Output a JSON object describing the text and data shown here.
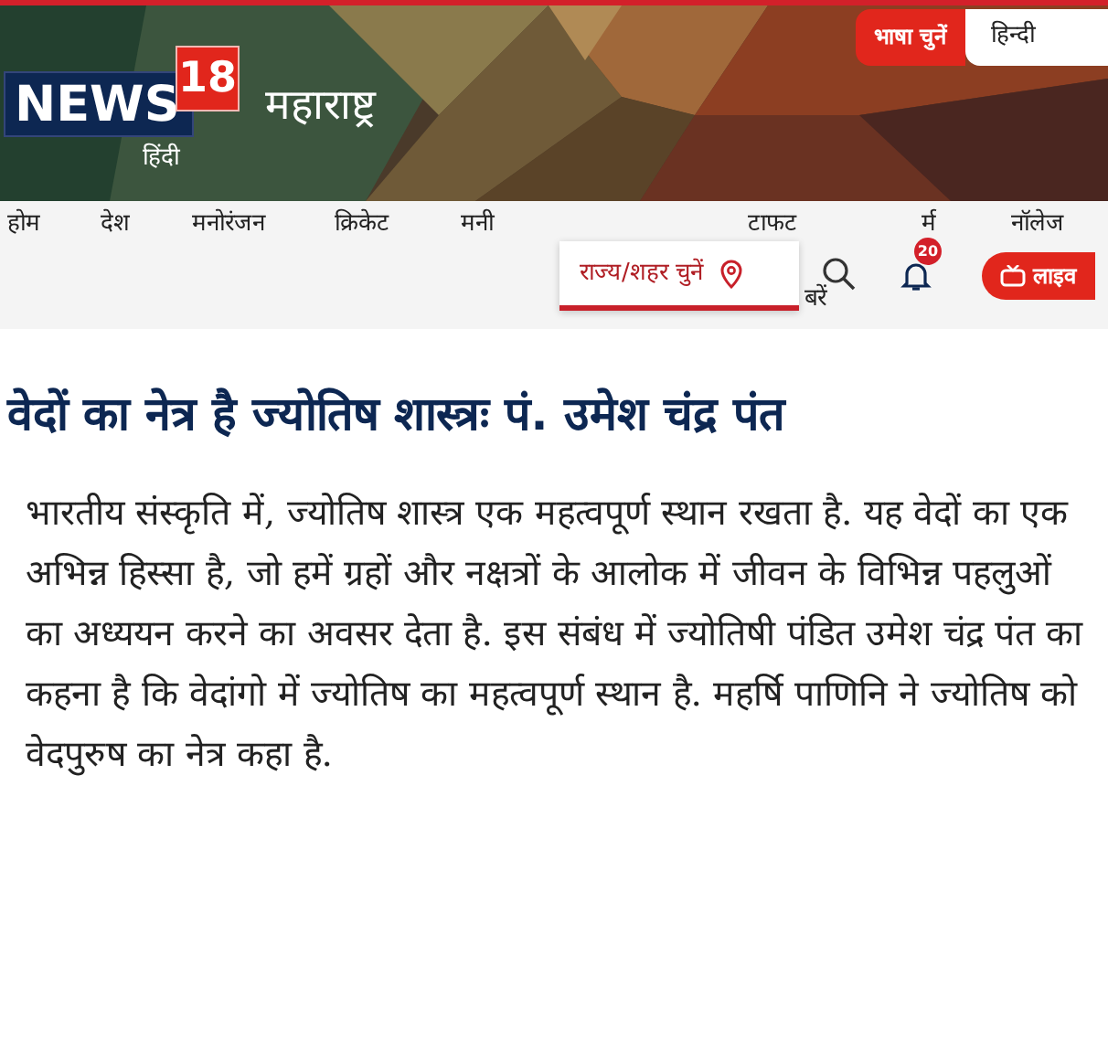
{
  "header": {
    "language_label": "भाषा चुनें",
    "language_value": "हिन्दी",
    "logo_word": "NEWS",
    "logo_number": "18",
    "logo_sub": "हिंदी",
    "section": "महाराष्ट्र"
  },
  "nav": {
    "items": [
      {
        "label": "होम"
      },
      {
        "label": "देश"
      },
      {
        "label": "मनोरंजन"
      },
      {
        "label": "क्रिकेट"
      },
      {
        "label": "मनी"
      },
      {
        "label": "टाफट"
      },
      {
        "label": "र्म"
      },
      {
        "label": "नॉलेज"
      }
    ],
    "wrapped_text": "बरें",
    "state_picker": "राज्य/शहर चुनें",
    "notification_count": "20",
    "live_label": "लाइव"
  },
  "article": {
    "headline": "वेदों का नेत्र है ज्योतिष शास्त्रः पं. उमेश चंद्र पंत",
    "body": "भारतीय संस्कृति में, ज्योतिष शास्त्र एक महत्वपूर्ण स्थान रखता है. यह वेदों का एक अभिन्न हिस्सा है, जो हमें ग्रहों और नक्षत्रों के आलोक में जीवन के विभिन्न पहलुओं का अध्ययन करने का अवसर देता है. इस संबंध में ज्योतिषी पंडित उमेश चंद्र पंत का कहना है कि वेदांगो में ज्योतिष का महत्वपूर्ण स्थान है. महर्षि पाणिनि ने ज्योतिष को वेदपुरुष का नेत्र कहा है."
  }
}
